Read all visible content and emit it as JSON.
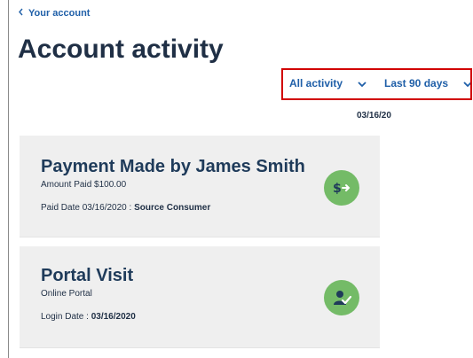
{
  "nav": {
    "back_label": "Your account"
  },
  "page": {
    "title": "Account activity"
  },
  "filters": {
    "activity_value": "All activity",
    "range_value": "Last 90 days"
  },
  "timeline": {
    "date_label": "03/16/20"
  },
  "activities": [
    {
      "title": "Payment Made by James Smith",
      "line1": "Amount Paid $100.00",
      "line2_prefix": "Paid Date 03/16/2020 : ",
      "line2_value": "Source Consumer",
      "icon": "dollar-arrow-icon"
    },
    {
      "title": "Portal Visit",
      "line1": "Online Portal",
      "line2_prefix": "Login Date : ",
      "line2_value": "03/16/2020",
      "icon": "user-check-icon"
    }
  ],
  "colors": {
    "link": "#1f5fa8",
    "title": "#1f2f45",
    "card_bg": "#efefef",
    "icon_green": "#74bb67",
    "highlight_red": "#d10000"
  }
}
